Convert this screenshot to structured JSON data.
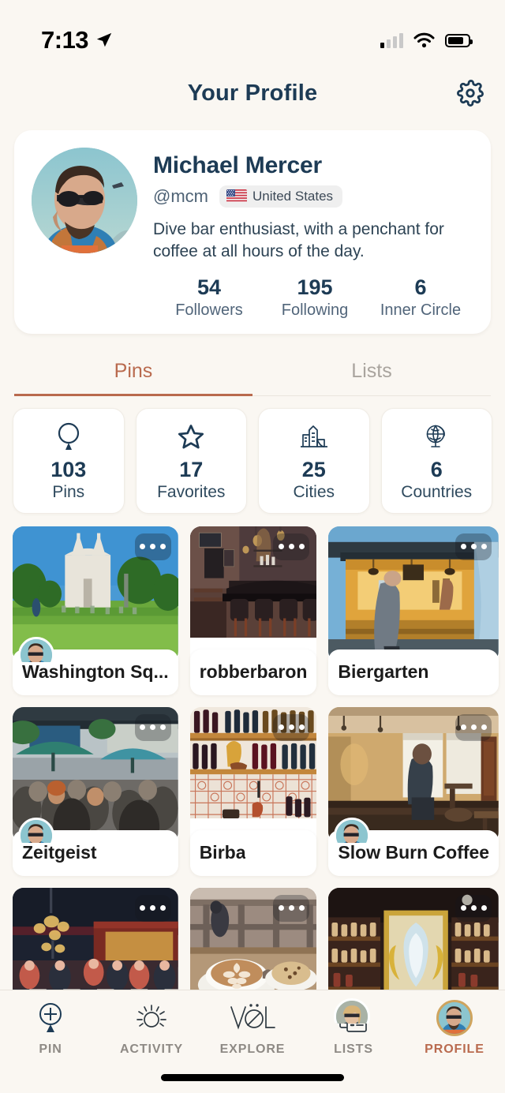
{
  "status_bar": {
    "time": "7:13",
    "location_icon": "location-arrow-icon",
    "signal_icon": "cellular-signal-icon",
    "wifi_icon": "wifi-icon",
    "battery_icon": "battery-icon"
  },
  "header": {
    "title": "Your Profile",
    "settings_icon": "gear-icon"
  },
  "profile": {
    "avatar": "user-avatar",
    "name": "Michael Mercer",
    "handle": "@mcm",
    "country": "United States",
    "country_flag": "united-states-flag",
    "bio": "Dive bar enthusiast, with a penchant for coffee at all hours of the day.",
    "stats": [
      {
        "value": "54",
        "label": "Followers"
      },
      {
        "value": "195",
        "label": "Following"
      },
      {
        "value": "6",
        "label": "Inner Circle"
      }
    ]
  },
  "tabs": [
    {
      "label": "Pins",
      "active": true
    },
    {
      "label": "Lists",
      "active": false
    }
  ],
  "stat_cards": [
    {
      "icon": "map-pin-icon",
      "value": "103",
      "label": "Pins"
    },
    {
      "icon": "star-icon",
      "value": "17",
      "label": "Favorites"
    },
    {
      "icon": "buildings-icon",
      "value": "25",
      "label": "Cities"
    },
    {
      "icon": "globe-icon",
      "value": "6",
      "label": "Countries"
    }
  ],
  "pins": [
    {
      "title": "Washington Sq...",
      "has_avatar": true,
      "menu_icon": "more-options-icon"
    },
    {
      "title": "robberbaron",
      "has_avatar": false,
      "menu_icon": "more-options-icon"
    },
    {
      "title": "Biergarten",
      "has_avatar": false,
      "menu_icon": "more-options-icon"
    },
    {
      "title": "Zeitgeist",
      "has_avatar": true,
      "menu_icon": "more-options-icon"
    },
    {
      "title": "Birba",
      "has_avatar": false,
      "menu_icon": "more-options-icon"
    },
    {
      "title": "Slow Burn Coffee",
      "has_avatar": true,
      "menu_icon": "more-options-icon"
    },
    {
      "title": "",
      "has_avatar": false,
      "menu_icon": "more-options-icon"
    },
    {
      "title": "",
      "has_avatar": false,
      "menu_icon": "more-options-icon"
    },
    {
      "title": "",
      "has_avatar": true,
      "menu_icon": "more-options-icon"
    }
  ],
  "bottom_nav": [
    {
      "label": "PIN",
      "icon": "add-pin-icon",
      "active": false
    },
    {
      "label": "ACTIVITY",
      "icon": "sun-icon",
      "active": false
    },
    {
      "label": "EXPLORE",
      "icon": "vol-logo-icon",
      "active": false
    },
    {
      "label": "LISTS",
      "icon": "lists-icon",
      "active": false
    },
    {
      "label": "PROFILE",
      "icon": "avatar-icon",
      "active": true
    }
  ],
  "colors": {
    "background": "#faf7f2",
    "card": "#ffffff",
    "navy": "#1d3b55",
    "accent": "#b96a4e",
    "muted": "#8e8a85",
    "avatar_ring": "#cfa45e"
  }
}
